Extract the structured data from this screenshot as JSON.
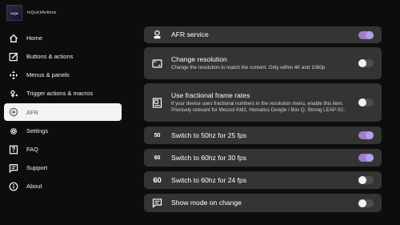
{
  "app": {
    "logo_text": "tvQA",
    "name": "tvQuickActions"
  },
  "sidebar": {
    "items": [
      {
        "label": "Home",
        "icon": "home-icon",
        "active": false
      },
      {
        "label": "Buttons & actions",
        "icon": "edit-box-icon",
        "active": false
      },
      {
        "label": "Menus & panels",
        "icon": "dpad-icon",
        "active": false
      },
      {
        "label": "Trigger actions & macros",
        "icon": "trigger-icon",
        "active": false
      },
      {
        "label": "AFR",
        "icon": "afr-icon",
        "active": true
      },
      {
        "label": "Settings",
        "icon": "gear-icon",
        "active": false
      },
      {
        "label": "FAQ",
        "icon": "faq-icon",
        "active": false
      },
      {
        "label": "Support",
        "icon": "chat-icon",
        "active": false
      },
      {
        "label": "About",
        "icon": "info-icon",
        "active": false
      }
    ]
  },
  "settings": [
    {
      "title": "AFR service",
      "description": "",
      "icon": "service-icon",
      "on": true
    },
    {
      "title": "Change resolution",
      "description": "Change the resolution to match the content. Only within 4K and 1080p",
      "icon": "resolution-icon",
      "on": false
    },
    {
      "title": "Use fractional frame rates",
      "description": "If your device uses fractional numbers in the resolution menu, enable this item. Precisely relevant for Mecool KM2, Homatics Dongle / Box Q, Strong LEAP-S1.",
      "icon": "fraction-icon",
      "on": false
    },
    {
      "title": "Switch to 50hz for 25 fps",
      "description": "",
      "icon": "50hz-icon",
      "glyph": "50",
      "on": true
    },
    {
      "title": "Switch to 60hz for 30 fps",
      "description": "",
      "icon": "60hz-icon",
      "glyph": "60",
      "on": true
    },
    {
      "title": "Switch to 60hz for 24 fps",
      "description": "",
      "icon": "60-icon",
      "glyph": "60",
      "on": false
    },
    {
      "title": "Show mode on change",
      "description": "",
      "icon": "message-icon",
      "on": false
    }
  ],
  "colors": {
    "toggle_on": "#9a7fc7",
    "knob_on": "#b89bf0",
    "card": "#343434",
    "background": "#0d0d0d"
  }
}
